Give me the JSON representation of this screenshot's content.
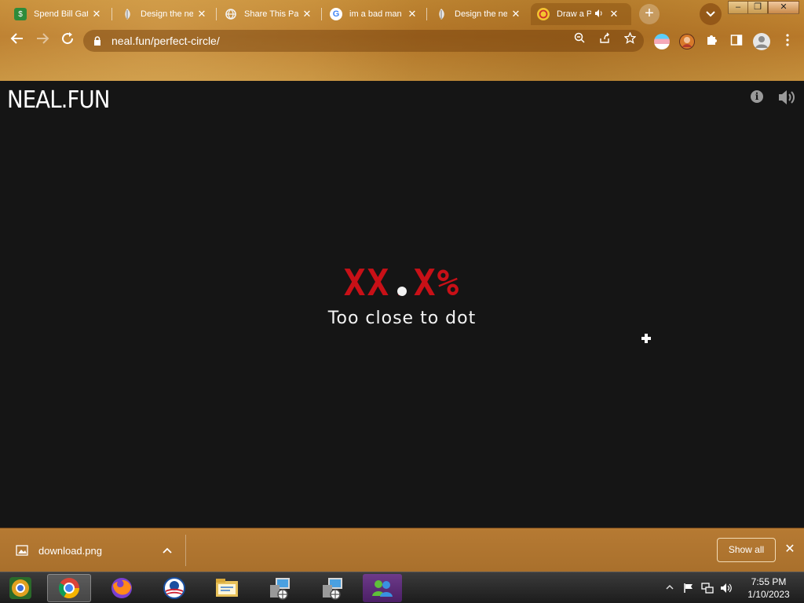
{
  "browser": {
    "tabs": [
      {
        "title": "Spend Bill Gates",
        "favicon": "money-icon",
        "active": false
      },
      {
        "title": "Design the next",
        "favicon": "feather-icon",
        "active": false
      },
      {
        "title": "Share This Page",
        "favicon": "globe-icon",
        "active": false
      },
      {
        "title": "im a bad man",
        "favicon": "google-icon",
        "active": false
      },
      {
        "title": "Design the next",
        "favicon": "feather-icon",
        "active": false
      },
      {
        "title": "Draw a Perfect Circle",
        "favicon": "circle-target-icon",
        "active": true,
        "audio": true
      }
    ],
    "close_glyph": "✕",
    "new_tab_glyph": "+",
    "address": "neal.fun/perfect-circle/",
    "window_buttons": {
      "minimize": "–",
      "restore": "❐",
      "close": "✕"
    }
  },
  "site": {
    "logo": "NEAL.FUN",
    "info_glyph": "i"
  },
  "game": {
    "score": "XX.X%",
    "message": "Too close to dot"
  },
  "downloads": {
    "file_name": "download.png",
    "show_all_label": "Show all",
    "close_glyph": "✕"
  },
  "taskbar": {
    "apps": [
      "chrome-canary-icon",
      "chrome-icon",
      "firefox-icon",
      "obama-logo-icon",
      "file-explorer-icon",
      "network-setup-icon",
      "network-setup-icon",
      "messenger-icon"
    ],
    "time": "7:55 PM",
    "date": "1/10/2023"
  },
  "colors": {
    "theme_tan": "#b8792a",
    "page_bg": "#151515",
    "score_red": "#c81017"
  }
}
